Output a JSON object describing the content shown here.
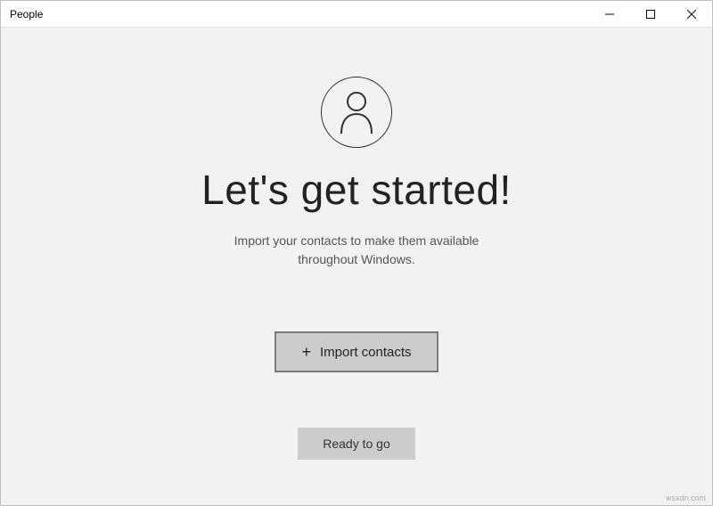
{
  "titlebar": {
    "title": "People"
  },
  "main": {
    "heading": "Let's get started!",
    "subtext": "Import your contacts to make them available throughout Windows.",
    "import_button_label": "Import contacts",
    "ready_button_label": "Ready to go"
  },
  "watermark": "wsxdn.com"
}
